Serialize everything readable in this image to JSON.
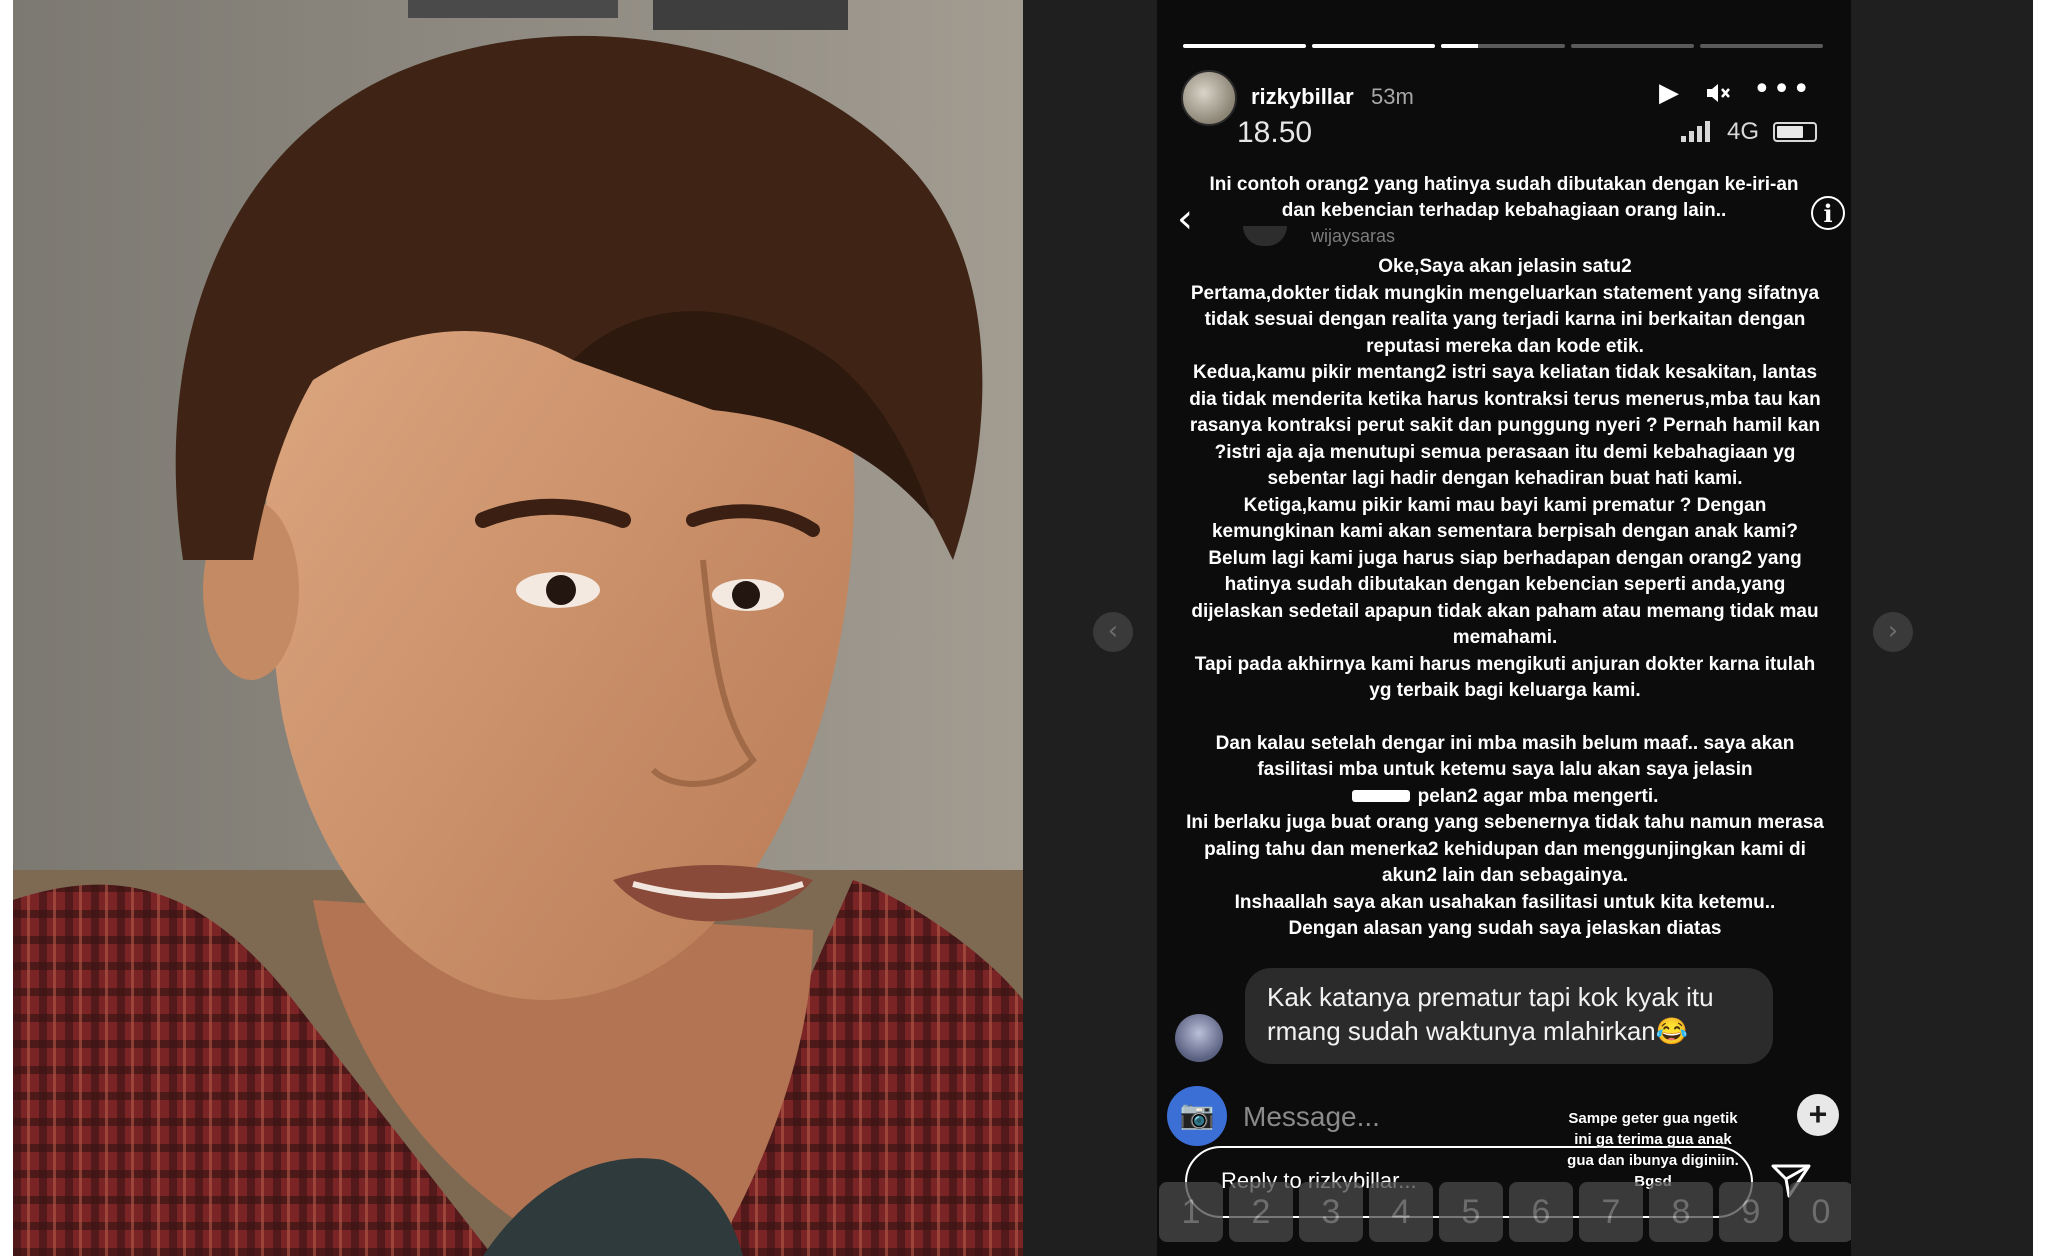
{
  "story": {
    "username": "rizkybillar",
    "time_ago": "53m",
    "clock": "18.50",
    "network": "4G",
    "progress_segments": [
      1,
      1,
      0.3,
      0,
      0
    ],
    "caption": "Ini contoh orang2 yang hatinya sudah dibutakan dengan ke-iri-an dan kebencian terhadap kebahagiaan orang lain..",
    "commenter": "wijaysaras",
    "body_lines": [
      "Oke,Saya akan jelasin satu2",
      "Pertama,dokter tidak mungkin mengeluarkan statement yang sifatnya tidak sesuai dengan realita yang terjadi karna ini berkaitan dengan reputasi mereka dan kode etik.",
      "Kedua,kamu pikir mentang2 istri saya keliatan tidak kesakitan, lantas dia tidak menderita ketika harus kontraksi terus menerus,mba tau kan rasanya kontraksi perut sakit dan punggung nyeri ? Pernah hamil kan ?istri aja aja menutupi semua perasaan itu demi kebahagiaan yg sebentar lagi hadir dengan kehadiran buat hati kami.",
      "Ketiga,kamu pikir kami mau bayi kami prematur ? Dengan kemungkinan kami akan sementara berpisah dengan anak kami? Belum lagi kami juga harus siap berhadapan dengan orang2 yang hatinya sudah dibutakan dengan kebencian seperti anda,yang dijelaskan sedetail apapun tidak akan paham atau memang tidak mau memahami.",
      "Tapi pada akhirnya kami harus mengikuti anjuran dokter karna itulah yg terbaik bagi keluarga kami."
    ],
    "body_lines_2": [
      "Dan kalau setelah dengar ini mba masih belum maaf.. saya akan fasilitasi mba untuk ketemu saya lalu akan saya jelasin",
      "pelan2 agar mba mengerti.",
      "Ini berlaku juga buat orang yang sebenernya tidak tahu namun merasa paling tahu dan menerka2 kehidupan dan menggunjingkan kami di akun2 lain dan sebagainya.",
      "Inshaallah saya akan usahakan fasilitasi untuk kita ketemu..",
      "Dengan alasan yang sudah saya jelaskan diatas"
    ],
    "reply_bubble": "Kak katanya prematur tapi kok kyak itu rmang sudah waktunya mlahirkan😂",
    "message_placeholder": "Message...",
    "reply_placeholder": "Reply to rizkybillar...",
    "overlay_note": "Sampe geter gua ngetik ini ga terima gua anak gua dan ibunya diginiin. Bgsd",
    "keyboard_keys": [
      "1",
      "2",
      "3",
      "4",
      "5",
      "6",
      "7",
      "8",
      "9",
      "0"
    ]
  },
  "icons": {
    "prev": "‹",
    "next": "›",
    "back": "‹",
    "info": "i",
    "play": "▶",
    "mute": "🔇",
    "more": "•••",
    "camera": "📷",
    "plus": "+"
  },
  "colors": {
    "viewer_bg": "#1f1f1f",
    "story_bg": "#0c0c0c",
    "camera_button": "#3b6fd6",
    "shirt_red": "#8a2a2a"
  }
}
